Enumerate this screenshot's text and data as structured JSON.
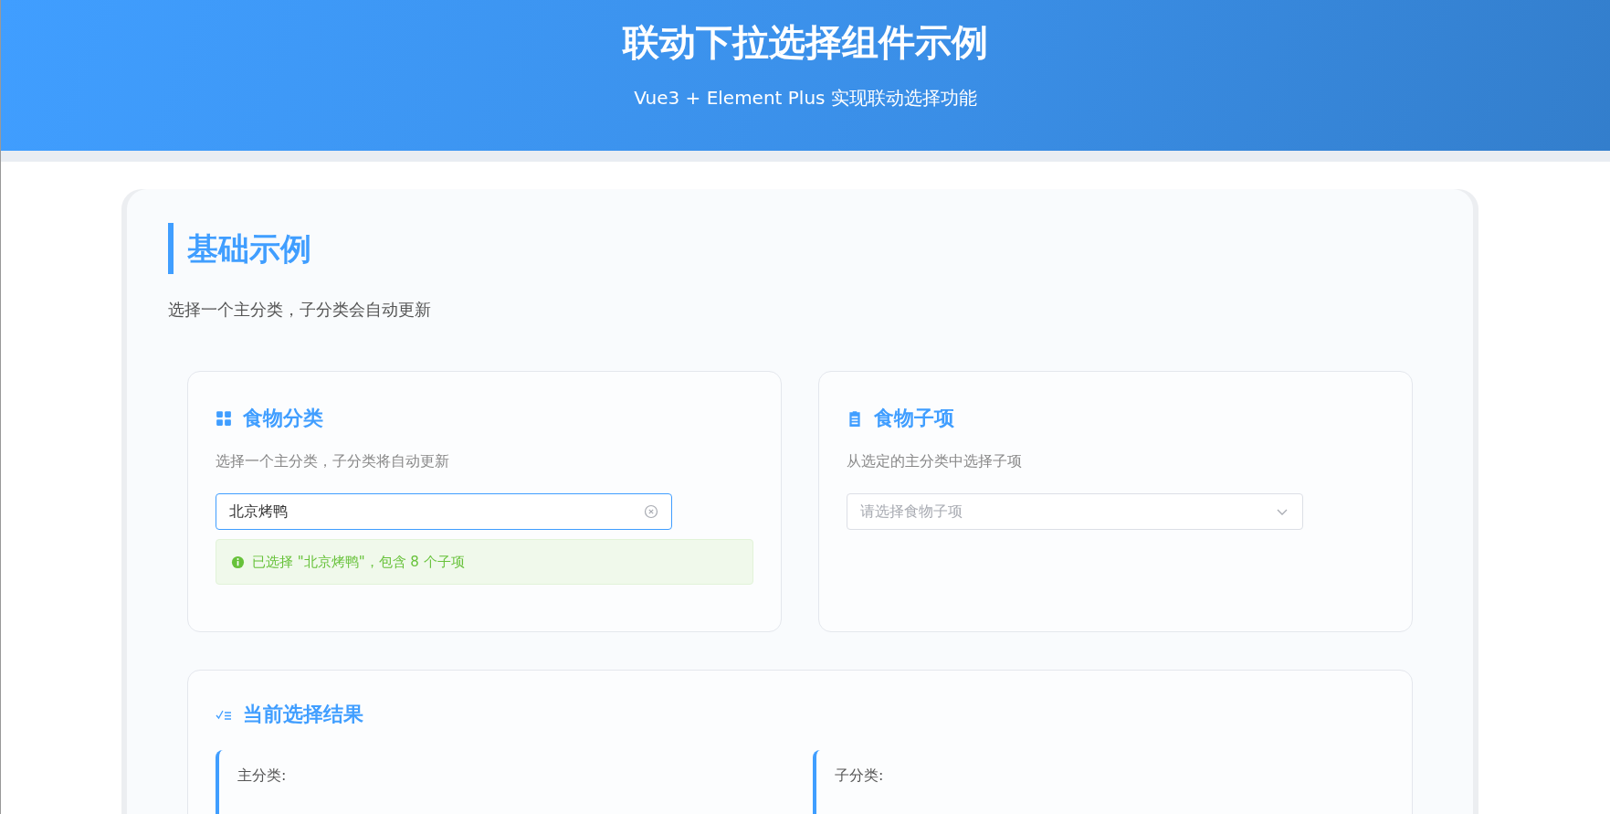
{
  "header": {
    "title": "联动下拉选择组件示例",
    "subtitle": "Vue3 + Element Plus 实现联动选择功能"
  },
  "section": {
    "title": "基础示例",
    "description": "选择一个主分类，子分类会自动更新"
  },
  "selectors": [
    {
      "title": "食物分类",
      "hint": "选择一个主分类，子分类将自动更新",
      "value": "北京烤鸭",
      "focused": true,
      "clearable": true,
      "notice": "已选择 \"北京烤鸭\"，包含 8 个子项"
    },
    {
      "title": "食物子项",
      "hint": "从选定的主分类中选择子项",
      "placeholder": "请选择食物子项",
      "focused": false,
      "clearable": false
    }
  ],
  "result": {
    "title": "当前选择结果",
    "items": [
      {
        "label": "主分类:"
      },
      {
        "label": "子分类:"
      }
    ]
  }
}
